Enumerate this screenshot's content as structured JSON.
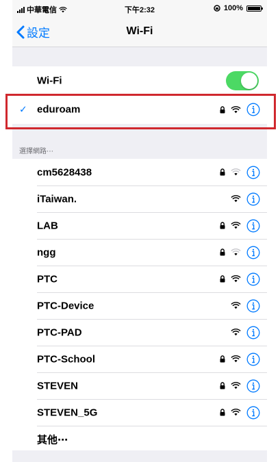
{
  "status": {
    "carrier": "中華電信",
    "time": "下午2:32",
    "battery": "100%",
    "battery_level": 1.0
  },
  "nav": {
    "back_label": "設定",
    "title": "Wi-Fi"
  },
  "wifi": {
    "label": "Wi-Fi",
    "enabled": true,
    "toggle_color": "#4cd964"
  },
  "connected": {
    "name": "eduroam",
    "secured": true
  },
  "section": {
    "header": "選擇網路⋯"
  },
  "networks": [
    {
      "name": "cm5628438",
      "secured": true,
      "strength": "weak"
    },
    {
      "name": "iTaiwan.",
      "secured": false,
      "strength": "full"
    },
    {
      "name": "LAB",
      "secured": true,
      "strength": "full"
    },
    {
      "name": "ngg",
      "secured": true,
      "strength": "weak"
    },
    {
      "name": "PTC",
      "secured": true,
      "strength": "full"
    },
    {
      "name": "PTC-Device",
      "secured": false,
      "strength": "full"
    },
    {
      "name": "PTC-PAD",
      "secured": false,
      "strength": "full"
    },
    {
      "name": "PTC-School",
      "secured": true,
      "strength": "full"
    },
    {
      "name": "STEVEN",
      "secured": true,
      "strength": "full"
    },
    {
      "name": "STEVEN_5G",
      "secured": true,
      "strength": "full"
    }
  ],
  "other": {
    "label": "其他⋯"
  },
  "colors": {
    "accent": "#007aff",
    "highlight": "#d0282e"
  }
}
